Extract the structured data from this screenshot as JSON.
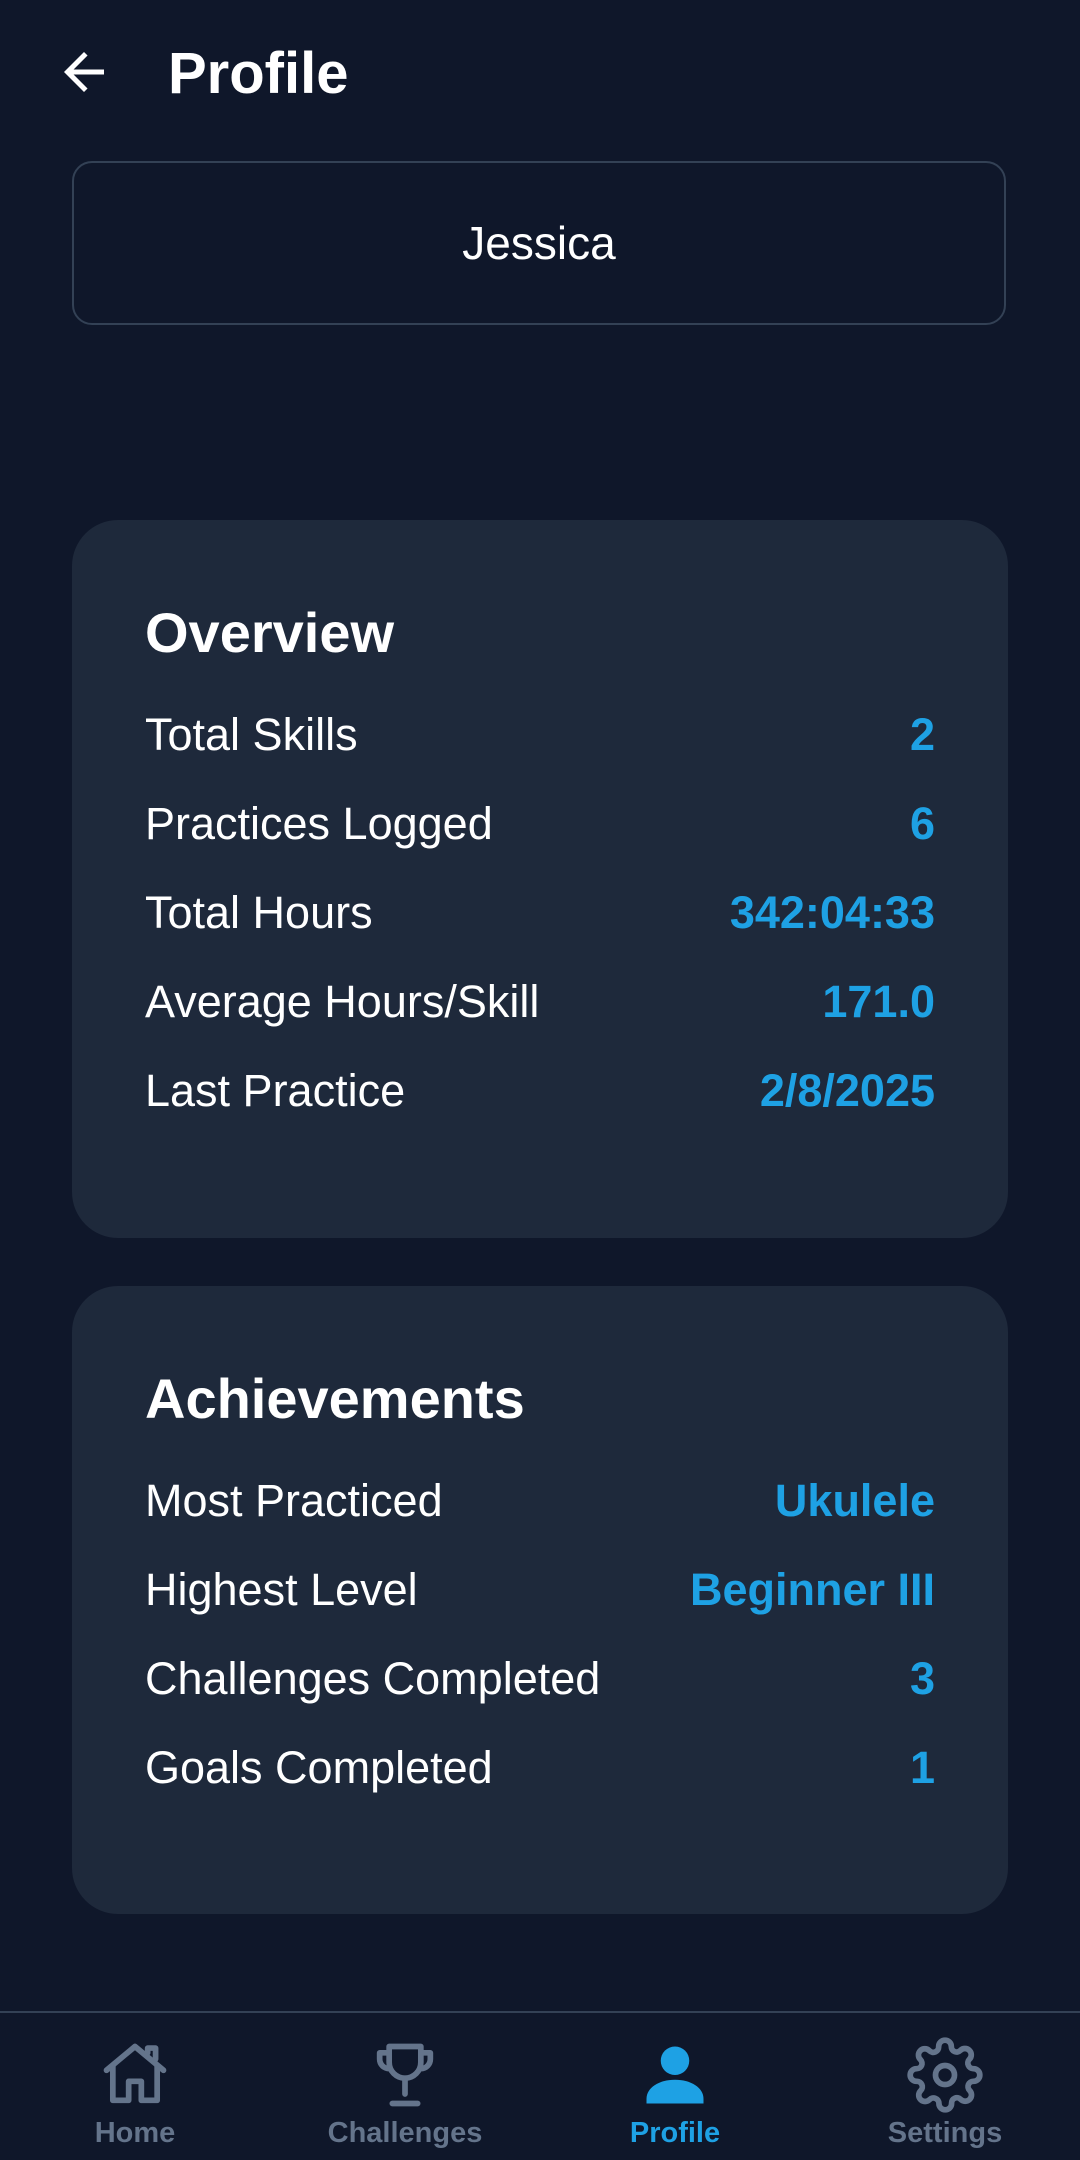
{
  "header": {
    "title": "Profile",
    "back_icon": "arrow-left-icon"
  },
  "profile": {
    "name": "Jessica"
  },
  "overview": {
    "title": "Overview",
    "rows": [
      {
        "label": "Total Skills",
        "value": "2"
      },
      {
        "label": "Practices Logged",
        "value": "6"
      },
      {
        "label": "Total Hours",
        "value": "342:04:33"
      },
      {
        "label": "Average Hours/Skill",
        "value": "171.0"
      },
      {
        "label": "Last Practice",
        "value": "2/8/2025"
      }
    ]
  },
  "achievements": {
    "title": "Achievements",
    "rows": [
      {
        "label": "Most Practiced",
        "value": "Ukulele"
      },
      {
        "label": "Highest Level",
        "value": "Beginner III"
      },
      {
        "label": "Challenges Completed",
        "value": "3"
      },
      {
        "label": "Goals Completed",
        "value": "1"
      }
    ]
  },
  "nav": {
    "items": [
      {
        "label": "Home",
        "icon": "home-icon",
        "active": false
      },
      {
        "label": "Challenges",
        "icon": "trophy-icon",
        "active": false
      },
      {
        "label": "Profile",
        "icon": "person-icon",
        "active": true
      },
      {
        "label": "Settings",
        "icon": "gear-icon",
        "active": false
      }
    ]
  },
  "colors": {
    "background": "#0f172a",
    "card": "#1e293b",
    "accent": "#1ea1e4",
    "inactive": "#64748b",
    "border": "#334155"
  }
}
